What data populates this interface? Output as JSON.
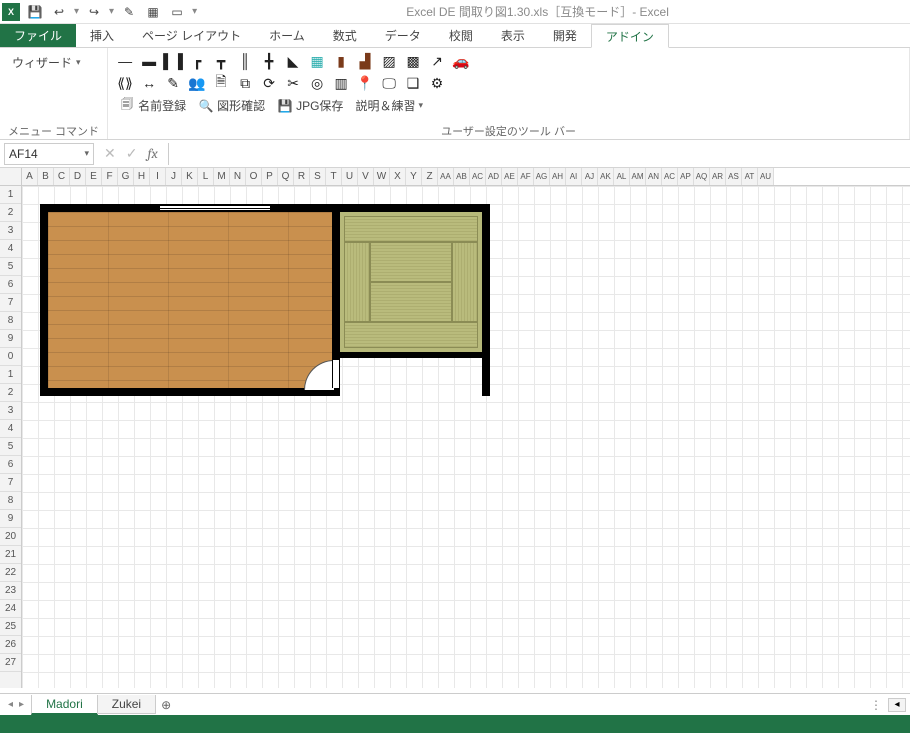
{
  "title": "Excel DE 間取り図1.30.xls［互換モード］- Excel",
  "qat": {
    "save": "💾",
    "undo": "↩",
    "redo": "↪"
  },
  "tabs": {
    "file": "ファイル",
    "insert": "挿入",
    "pagelayout": "ページ レイアウト",
    "home": "ホーム",
    "formulas": "数式",
    "data": "データ",
    "review": "校閲",
    "view": "表示",
    "developer": "開発",
    "addin": "アドイン"
  },
  "ribbon": {
    "wizard": "ウィザード",
    "name_register": "名前登録",
    "shape_confirm": "図形確認",
    "jpg_save": "JPG保存",
    "explain_practice": "説明＆練習",
    "group_label": "ユーザー設定のツール バー",
    "menu_commands": "メニュー コマンド"
  },
  "namebox": "AF14",
  "columns": [
    "A",
    "B",
    "C",
    "D",
    "E",
    "F",
    "G",
    "H",
    "I",
    "J",
    "K",
    "L",
    "M",
    "N",
    "O",
    "P",
    "Q",
    "R",
    "S",
    "T",
    "U",
    "V",
    "W",
    "X",
    "Y",
    "Z",
    "AA",
    "AB",
    "AC",
    "AD",
    "AE",
    "AF",
    "AG",
    "AH",
    "AI",
    "AJ",
    "AK",
    "AL",
    "AM",
    "AN",
    "AC",
    "AP",
    "AQ",
    "AR",
    "AS",
    "AT",
    "AU"
  ],
  "rows": [
    "1",
    "2",
    "3",
    "4",
    "5",
    "6",
    "7",
    "8",
    "9",
    "0",
    "1",
    "2",
    "3",
    "4",
    "5",
    "6",
    "7",
    "8",
    "9",
    "20",
    "21",
    "22",
    "23",
    "24",
    "25",
    "26",
    "27"
  ],
  "sheets": {
    "s1": "Madori",
    "s2": "Zukei"
  },
  "icons": {
    "line_h": "—",
    "line_thick": "▬",
    "pillar": "▌▐",
    "corner": "┏",
    "t": "┳",
    "dbl": "║",
    "plus": "╋",
    "triangle": "◣",
    "door_blue": "▦",
    "brown1": "▮",
    "stairs": "▟",
    "hatch": "▨",
    "grid": "▩",
    "arrow": "↗",
    "car": "🚗",
    "scale": "⟪⟫",
    "cursor": "↔",
    "note": "✎",
    "people": "👥",
    "doc": "🗎",
    "copy": "⧉",
    "rotate": "⟳",
    "crop": "✂",
    "target": "◎",
    "boxdots": "▥",
    "pin": "📍",
    "tv": "🖵",
    "layers": "❑",
    "gear": "⚙"
  }
}
